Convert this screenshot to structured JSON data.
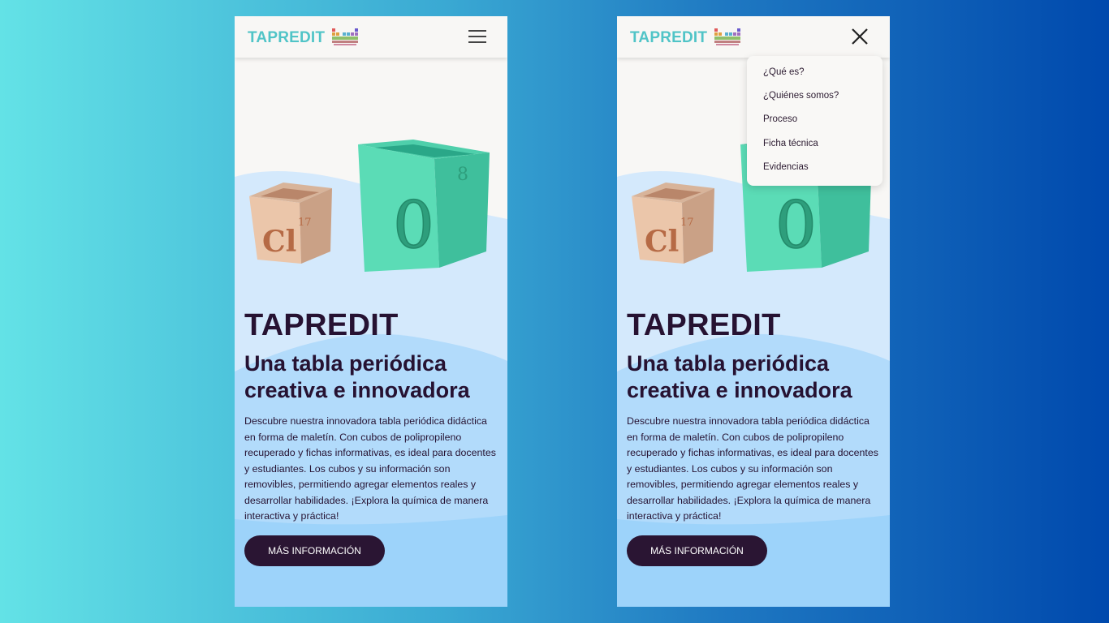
{
  "brand": {
    "name": "TAPREDIT",
    "color": "#50c4c7"
  },
  "hero": {
    "title": "TAPREDIT",
    "subtitle": "Una tabla periódica creativa e innovadora",
    "description": "Descubre nuestra innovadora tabla periódica didáctica en forma de maletín. Con cubos de polipropileno recuperado y fichas informativas, es ideal para docentes y estudiantes. Los cubos y su información son removibles, permitiendo agregar elementos reales y desarrollar habilidades. ¡Explora la química de manera interactiva y práctica!",
    "cta_label": "MÁS INFORMACIÓN",
    "cubes": {
      "small": {
        "symbol": "Cl",
        "number": "17"
      },
      "large": {
        "symbol": "O",
        "number": "8"
      }
    }
  },
  "menu": {
    "items": [
      {
        "label": "¿Qué es?"
      },
      {
        "label": "¿Quiénes somos?"
      },
      {
        "label": "Proceso"
      },
      {
        "label": "Ficha técnica"
      },
      {
        "label": "Evidencias"
      }
    ]
  },
  "colors": {
    "text_dark": "#261232",
    "button_bg": "#2a1533",
    "wave_light": "#cfe6fb",
    "wave_mid": "#a9d7fb",
    "wave_deep": "#8fcff9"
  },
  "icons": {
    "menu": "hamburger-icon",
    "close": "close-icon",
    "logo": "periodic-table-logo-icon"
  }
}
